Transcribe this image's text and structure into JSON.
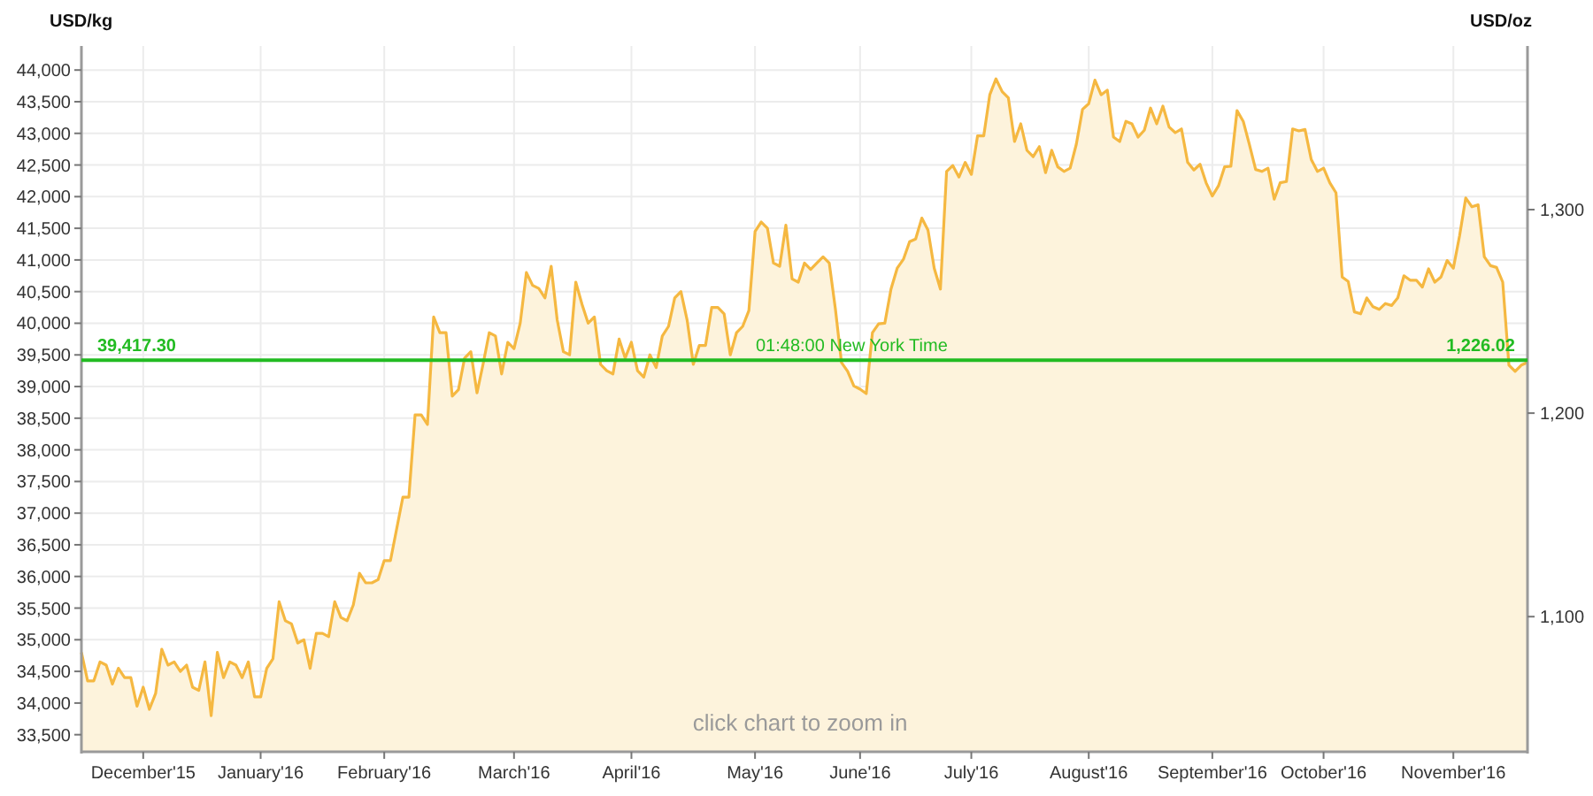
{
  "chart": {
    "hint": "click chart to zoom in",
    "chart_data": {
      "type": "area",
      "ylabel": "USD/kg",
      "y2label": "USD/oz",
      "categories": [
        null,
        null,
        null,
        null,
        null,
        null,
        null,
        null,
        null,
        null,
        "December'15",
        null,
        null,
        null,
        null,
        null,
        null,
        null,
        null,
        null,
        null,
        null,
        null,
        null,
        null,
        null,
        null,
        null,
        null,
        "January'16",
        null,
        null,
        null,
        null,
        null,
        null,
        null,
        null,
        null,
        null,
        null,
        null,
        null,
        null,
        null,
        null,
        null,
        null,
        null,
        "February'16",
        null,
        null,
        null,
        null,
        null,
        null,
        null,
        null,
        null,
        null,
        null,
        null,
        null,
        null,
        null,
        null,
        null,
        null,
        null,
        null,
        "March'16",
        null,
        null,
        null,
        null,
        null,
        null,
        null,
        null,
        null,
        null,
        null,
        null,
        null,
        null,
        null,
        null,
        null,
        null,
        "April'16",
        null,
        null,
        null,
        null,
        null,
        null,
        null,
        null,
        null,
        null,
        null,
        null,
        null,
        null,
        null,
        null,
        null,
        null,
        null,
        "May'16",
        null,
        null,
        null,
        null,
        null,
        null,
        null,
        null,
        null,
        null,
        null,
        null,
        null,
        null,
        null,
        null,
        "June'16",
        null,
        null,
        null,
        null,
        null,
        null,
        null,
        null,
        null,
        null,
        null,
        null,
        null,
        null,
        null,
        null,
        null,
        "July'16",
        null,
        null,
        null,
        null,
        null,
        null,
        null,
        null,
        null,
        null,
        null,
        null,
        null,
        null,
        null,
        null,
        null,
        null,
        "August'16",
        null,
        null,
        null,
        null,
        null,
        null,
        null,
        null,
        null,
        null,
        null,
        null,
        null,
        null,
        null,
        null,
        null,
        null,
        null,
        "September'16",
        null,
        null,
        null,
        null,
        null,
        null,
        null,
        null,
        null,
        null,
        null,
        null,
        null,
        null,
        null,
        null,
        null,
        "October'16",
        null,
        null,
        null,
        null,
        null,
        null,
        null,
        null,
        null,
        null,
        null,
        null,
        null,
        null,
        null,
        null,
        null,
        null,
        null,
        null,
        "November'16",
        null,
        null,
        null,
        null,
        null,
        null,
        null,
        null,
        null,
        null,
        null,
        null
      ],
      "series": [
        {
          "color": "#f5b841",
          "values": [
            34800,
            34350,
            34350,
            34650,
            34600,
            34300,
            34550,
            34400,
            34400,
            33950,
            34250,
            33900,
            34150,
            34850,
            34600,
            34650,
            34500,
            34600,
            34250,
            34200,
            34650,
            33800,
            34800,
            34400,
            34650,
            34600,
            34400,
            34650,
            34100,
            34100,
            34550,
            34700,
            35600,
            35300,
            35250,
            34950,
            35000,
            34550,
            35100,
            35100,
            35050,
            35600,
            35350,
            35300,
            35550,
            36050,
            35900,
            35900,
            35950,
            36250,
            36250,
            36750,
            37250,
            37250,
            38550,
            38550,
            38400,
            40100,
            39850,
            39850,
            38850,
            38950,
            39450,
            39550,
            38900,
            39350,
            39850,
            39800,
            39200,
            39700,
            39600,
            40000,
            40800,
            40600,
            40550,
            40400,
            40900,
            40050,
            39550,
            39500,
            40650,
            40300,
            40000,
            40100,
            39350,
            39250,
            39200,
            39750,
            39450,
            39700,
            39250,
            39150,
            39500,
            39300,
            39800,
            39950,
            40400,
            40500,
            40050,
            39350,
            39650,
            39650,
            40250,
            40250,
            40150,
            39500,
            39850,
            39950,
            40200,
            41450,
            41600,
            41500,
            40950,
            40900,
            41550,
            40700,
            40650,
            40950,
            40850,
            40950,
            41050,
            40950,
            40220,
            39380,
            39240,
            39010,
            38960,
            38890,
            39850,
            39990,
            40000,
            40540,
            40870,
            41010,
            41290,
            41330,
            41660,
            41470,
            40870,
            40540,
            42400,
            42490,
            42310,
            42540,
            42350,
            42960,
            42960,
            43610,
            43860,
            43660,
            43560,
            42870,
            43150,
            42730,
            42630,
            42790,
            42380,
            42730,
            42470,
            42400,
            42450,
            42830,
            43380,
            43470,
            43840,
            43610,
            43680,
            42940,
            42870,
            43190,
            43150,
            42940,
            43050,
            43400,
            43150,
            43430,
            43100,
            43010,
            43070,
            42540,
            42420,
            42510,
            42220,
            42010,
            42170,
            42470,
            42480,
            43360,
            43190,
            42820,
            42430,
            42400,
            42450,
            41960,
            42220,
            42240,
            43070,
            43040,
            43060,
            42590,
            42400,
            42450,
            42220,
            42060,
            40730,
            40660,
            40180,
            40150,
            40400,
            40260,
            40220,
            40310,
            40280,
            40400,
            40750,
            40680,
            40680,
            40570,
            40860,
            40650,
            40730,
            40990,
            40870,
            41380,
            41980,
            41840,
            41870,
            41050,
            40910,
            40880,
            40650,
            39340,
            39240,
            39340,
            39380
          ]
        }
      ],
      "ylim": [
        33230,
        44380
      ],
      "y2lim": [
        1033.6,
        1380.4
      ],
      "yticks": [
        {
          "value": 33500,
          "label": "33,500"
        },
        {
          "value": 34000,
          "label": "34,000"
        },
        {
          "value": 34500,
          "label": "34,500"
        },
        {
          "value": 35000,
          "label": "35,000"
        },
        {
          "value": 35500,
          "label": "35,500"
        },
        {
          "value": 36000,
          "label": "36,000"
        },
        {
          "value": 36500,
          "label": "36,500"
        },
        {
          "value": 37000,
          "label": "37,000"
        },
        {
          "value": 37500,
          "label": "37,500"
        },
        {
          "value": 38000,
          "label": "38,000"
        },
        {
          "value": 38500,
          "label": "38,500"
        },
        {
          "value": 39000,
          "label": "39,000"
        },
        {
          "value": 39500,
          "label": "39,500"
        },
        {
          "value": 40000,
          "label": "40,000"
        },
        {
          "value": 40500,
          "label": "40,500"
        },
        {
          "value": 41000,
          "label": "41,000"
        },
        {
          "value": 41500,
          "label": "41,500"
        },
        {
          "value": 42000,
          "label": "42,000"
        },
        {
          "value": 42500,
          "label": "42,500"
        },
        {
          "value": 43000,
          "label": "43,000"
        },
        {
          "value": 43500,
          "label": "43,500"
        },
        {
          "value": 44000,
          "label": "44,000"
        }
      ],
      "y2ticks": [
        {
          "value": 1100,
          "label": "1,100"
        },
        {
          "value": 1200,
          "label": "1,200"
        },
        {
          "value": 1300,
          "label": "1,300"
        }
      ],
      "grid": true,
      "ref_lines": [
        {
          "axis": "y",
          "value": 39417.3,
          "label": "39,417.30"
        }
      ],
      "annotations": [
        "01:48:00 New York Time",
        "1,226.02"
      ]
    }
  }
}
